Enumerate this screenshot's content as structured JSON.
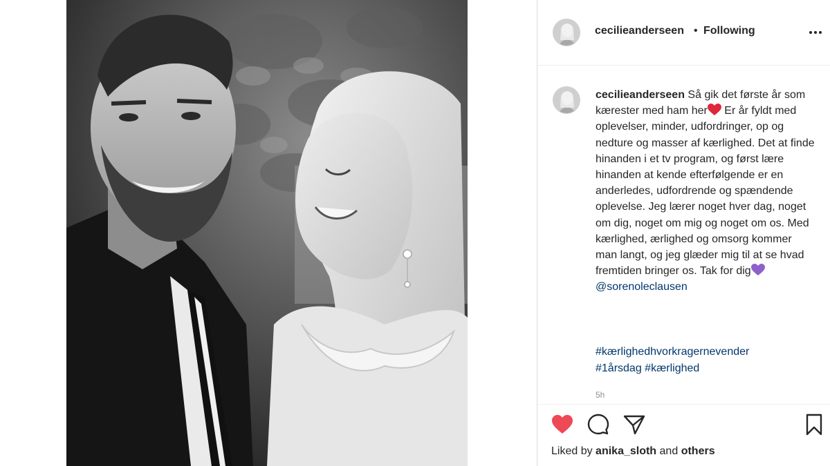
{
  "post": {
    "username": "cecilieanderseen",
    "follow_separator": "•",
    "follow_status": "Following"
  },
  "caption": {
    "author": "cecilieanderseen",
    "text_part1": "Så gik det første år som kærester med ham her",
    "text_part2": "Er år fyldt med oplevelser, minder, udfordringer, op og nedture og masser af kærlighed. Det at finde hinanden i et tv program, og først lære hinanden at kende efterfølgende er en anderledes, udfordrende og spændende oplevelse. Jeg lærer noget hver dag, noget om dig, noget om mig og noget om os. Med kærlighed, ærlighed og omsorg kommer man langt, og jeg glæder mig til at se hvad fremtiden bringer os. Tak for dig",
    "mention": "@sorenoleclausen",
    "hashtag_line1": "#kærlighedhvorkragernevender",
    "hashtag_line2a": "#1årsdag",
    "hashtag_line2b": "#kærlighed",
    "time": "5h"
  },
  "likes": {
    "prefix": "Liked by",
    "user": "anika_sloth",
    "conjunction": "and",
    "others": "others"
  },
  "icons": {
    "heart": "heart-filled-icon",
    "comment": "comment-icon",
    "share": "share-icon",
    "save": "bookmark-icon",
    "more": "more-icon",
    "emoji_red_heart": "red-heart-emoji",
    "emoji_purple_heart": "purple-heart-emoji"
  },
  "colors": {
    "like_red": "#ed4956",
    "link_blue": "#00376b",
    "heart_emoji_red": "#e0263a",
    "heart_emoji_purple": "#8d61c9",
    "muted_gray": "#8e8e8e"
  }
}
